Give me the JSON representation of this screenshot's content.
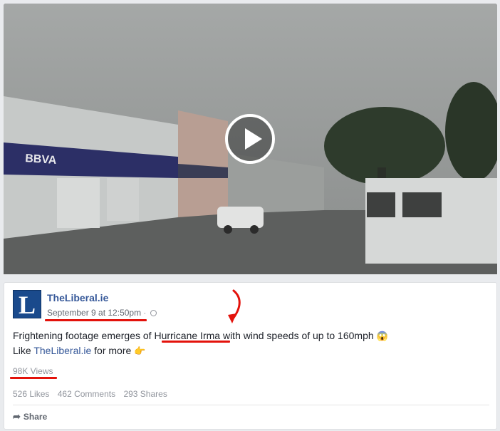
{
  "post": {
    "page_name": "TheLiberal.ie",
    "avatar_letter": "L",
    "date": "September 9 at 12:50pm",
    "separator": " · ",
    "text_line1_before": "Frightening footage emerges of ",
    "text_highlight": "Hurricane Irma",
    "text_line1_after": " with wind speeds of up to 160mph ",
    "text_line1_emoji": "😱",
    "text_line2_before": "Like ",
    "text_line2_link": "TheLiberal.ie",
    "text_line2_after": " for more ",
    "text_line2_emoji": "👉",
    "views": "98K Views",
    "likes": "526 Likes",
    "comments": "462 Comments",
    "shares": "293 Shares",
    "share_label": "Share",
    "share_icon": "share-arrow-icon"
  },
  "video": {
    "play_icon": "play-icon"
  },
  "colors": {
    "link": "#365899",
    "annotation": "#e3120b",
    "avatar_bg": "#1a4a8c"
  }
}
